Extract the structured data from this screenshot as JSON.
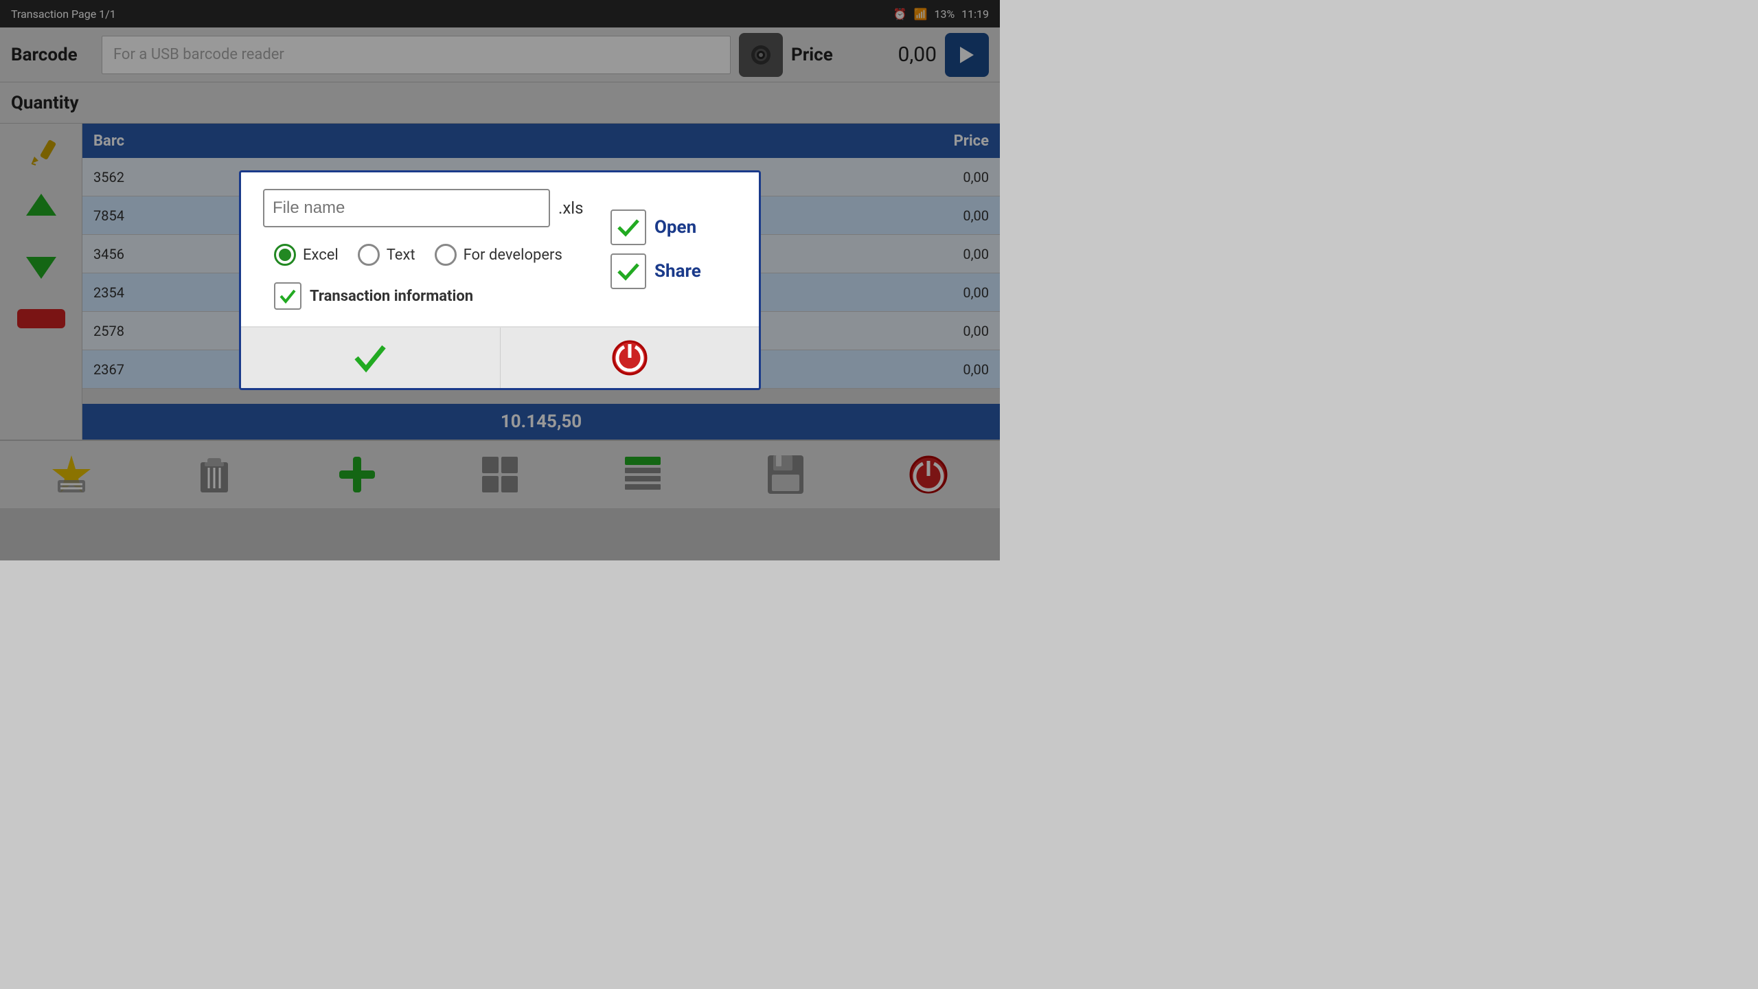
{
  "statusBar": {
    "title": "Transaction Page 1/1",
    "battery": "13%",
    "time": "11:19",
    "icons": [
      "alarm",
      "signal",
      "battery"
    ]
  },
  "header": {
    "barcodeLabel": "Barcode",
    "barcodeInputPlaceholder": "For a USB barcode reader",
    "priceLabel": "Price",
    "priceValue": "0,00"
  },
  "quantityRow": {
    "label": "Quantity"
  },
  "table": {
    "columns": [
      "Barc",
      "Price"
    ],
    "rows": [
      {
        "barcode": "3562",
        "price": "0,00"
      },
      {
        "barcode": "7854",
        "price": "0,00"
      },
      {
        "barcode": "3456",
        "price": "0,00"
      },
      {
        "barcode": "2354",
        "price": "0,00"
      },
      {
        "barcode": "2578",
        "price": "0,00"
      },
      {
        "barcode": "2367",
        "price": "0,00"
      }
    ],
    "total": "10.145,50"
  },
  "modal": {
    "fileNamePlaceholder": "File name",
    "fileExt": ".xls",
    "radioOptions": [
      {
        "id": "excel",
        "label": "Excel",
        "selected": true
      },
      {
        "id": "text",
        "label": "Text",
        "selected": false
      },
      {
        "id": "developers",
        "label": "For developers",
        "selected": false
      }
    ],
    "checkboxLabel": "Transaction information",
    "checkboxChecked": true,
    "openLabel": "Open",
    "shareLabel": "Share",
    "confirmIcon": "✔",
    "cancelIcon": "power"
  },
  "bottomToolbar": {
    "buttons": [
      "star-menu",
      "trash",
      "plus",
      "grid",
      "table",
      "save",
      "power"
    ]
  }
}
